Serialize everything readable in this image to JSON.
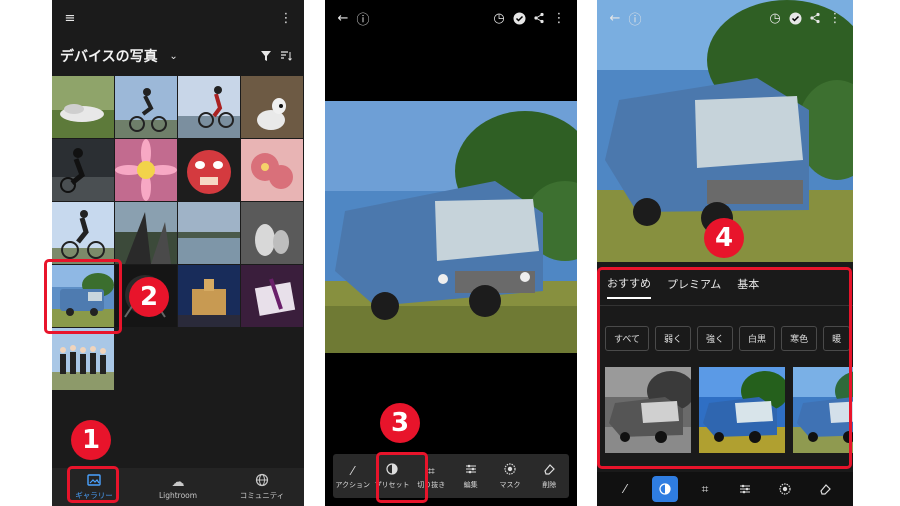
{
  "gallery": {
    "album_title": "デバイスの写真",
    "nav": [
      {
        "label": "ギャラリー",
        "icon": "gallery-icon",
        "active": true
      },
      {
        "label": "Lightroom",
        "icon": "cloud-icon",
        "active": false
      },
      {
        "label": "コミュニティ",
        "icon": "globe-icon",
        "active": false
      }
    ]
  },
  "editor": {
    "tools": [
      {
        "label": "アクション",
        "icon": "magic-wand-icon"
      },
      {
        "label": "プリセット",
        "icon": "preset-icon"
      },
      {
        "label": "切り抜き",
        "icon": "crop-icon"
      },
      {
        "label": "編集",
        "icon": "sliders-icon"
      },
      {
        "label": "マスク",
        "icon": "mask-icon"
      },
      {
        "label": "削除",
        "icon": "eraser-icon"
      }
    ]
  },
  "presets_panel": {
    "tabs": [
      "おすすめ",
      "プレミアム",
      "基本"
    ],
    "chips": [
      "すべて",
      "弱く",
      "強く",
      "白黒",
      "寒色",
      "暖"
    ]
  },
  "callouts": [
    "1",
    "2",
    "3",
    "4"
  ],
  "colors": {
    "callout": "#e8142b",
    "accent": "#4aa2ff",
    "active_tool": "#2f7de1"
  }
}
